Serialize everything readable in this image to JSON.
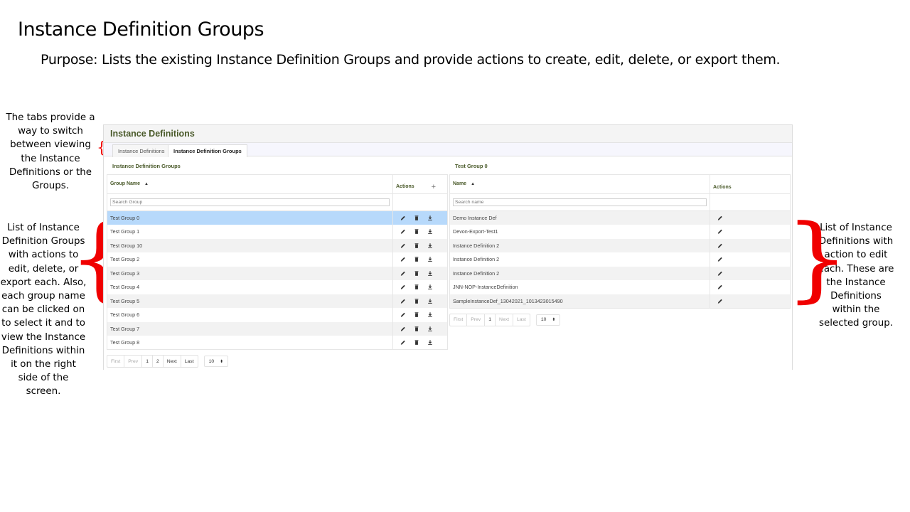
{
  "slide": {
    "title": "Instance Definition Groups",
    "purpose": "Purpose: Lists the existing Instance Definition Groups and provide actions to create, edit, delete, or export them."
  },
  "annotations": {
    "tabs_note": "The tabs provide a way to switch between viewing the Instance Definitions or the Groups.",
    "left_note": "List of Instance Definition Groups with actions to edit, delete, or export each. Also, each group name can be clicked on to select it and to view the Instance Definitions within it on the right side of the screen.",
    "right_note": "List of Instance Definitions with action to edit each. These are the Instance Definitions within the selected group.",
    "brace_left": "{",
    "brace_right": "}",
    "brace_color": "#f00000"
  },
  "app": {
    "title": "Instance Definitions",
    "tabs": [
      {
        "label": "Instance Definitions",
        "active": false
      },
      {
        "label": "Instance Definition Groups",
        "active": true
      }
    ]
  },
  "groups_panel": {
    "caption": "Instance Definition Groups",
    "columns": {
      "name": "Group Name",
      "actions": "Actions"
    },
    "sort_icon": "▲",
    "add_icon": "+",
    "search_placeholder": "Search Group",
    "rows": [
      {
        "name": "Test Group 0",
        "selected": true
      },
      {
        "name": "Test Group 1"
      },
      {
        "name": "Test Group 10"
      },
      {
        "name": "Test Group 2"
      },
      {
        "name": "Test Group 3"
      },
      {
        "name": "Test Group 4"
      },
      {
        "name": "Test Group 5"
      },
      {
        "name": "Test Group 6"
      },
      {
        "name": "Test Group 7"
      },
      {
        "name": "Test Group 8"
      }
    ],
    "pagination": {
      "first": "First",
      "prev": "Prev",
      "pages": [
        "1",
        "2"
      ],
      "next": "Next",
      "last": "Last",
      "page_size": "10"
    }
  },
  "definitions_panel": {
    "caption": "Test Group 0",
    "columns": {
      "name": "Name",
      "actions": "Actions"
    },
    "sort_icon": "▲",
    "search_placeholder": "Search name",
    "rows": [
      {
        "name": "Demo Instance Def"
      },
      {
        "name": "Devon-Export-Test1"
      },
      {
        "name": "Instance Definition 2"
      },
      {
        "name": "Instance Definition 2"
      },
      {
        "name": "Instance Definition 2"
      },
      {
        "name": "JNN-NOP-InstanceDefinition"
      },
      {
        "name": "SampleInstanceDef_13042021_1013423015490"
      }
    ],
    "pagination": {
      "first": "First",
      "prev": "Prev",
      "pages": [
        "1"
      ],
      "next": "Next",
      "last": "Last",
      "page_size": "10"
    }
  },
  "colors": {
    "selected_row": "#b7d9fb",
    "header_text": "#4a5a2a"
  }
}
